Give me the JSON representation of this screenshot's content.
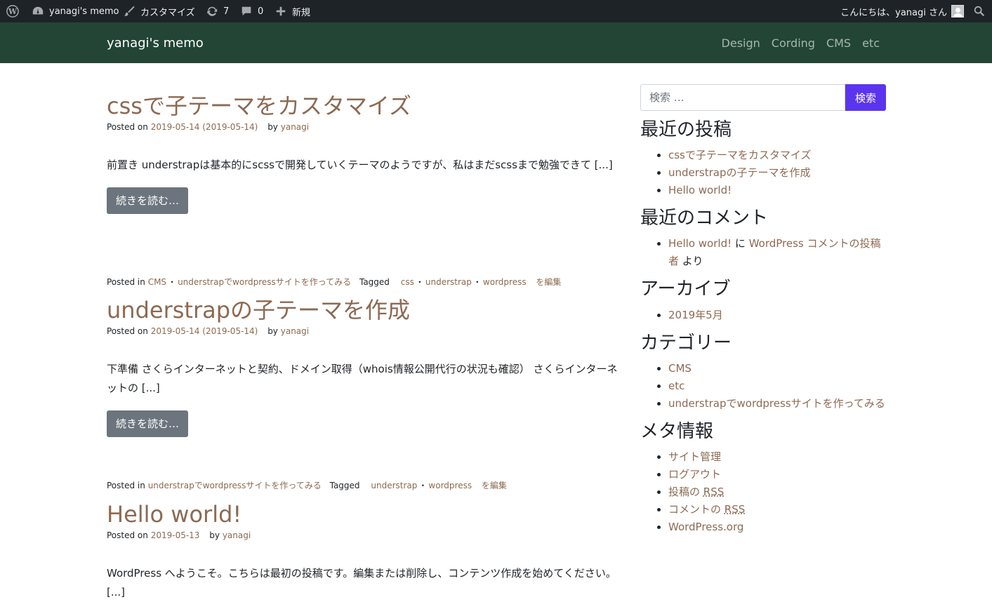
{
  "adminbar": {
    "site_name": "yanagi's memo",
    "customize": "カスタマイズ",
    "updates": "7",
    "comments": "0",
    "new": "新規",
    "greeting": "こんにちは、yanagi さん"
  },
  "navbar": {
    "brand": "yanagi's memo",
    "menu": [
      "Design",
      "Cording",
      "CMS",
      "etc"
    ]
  },
  "posts": [
    {
      "title": "cssで子テーマをカスタマイズ",
      "posted_on_label": "Posted on",
      "date": "2019-05-14 (2019-05-14)",
      "by_label": "by",
      "author": "yanagi",
      "excerpt": "前置き understrapは基本的にscssで開発していくテーマのようですが、私はまだscssまで勉強できて [...]",
      "read_more": "続きを読む…",
      "posted_in_label": "Posted in",
      "categories": [
        "CMS",
        "understrapでwordpressサイトを作ってみる"
      ],
      "tagged_label": "Tagged",
      "tags": [
        "css",
        "understrap",
        "wordpress"
      ],
      "edit": "を編集"
    },
    {
      "title": "understrapの子テーマを作成",
      "posted_on_label": "Posted on",
      "date": "2019-05-14 (2019-05-14)",
      "by_label": "by",
      "author": "yanagi",
      "excerpt": "下準備 さくらインターネットと契約、ドメイン取得（whois情報公開代行の状況も確認） さくらインターネットの [...]",
      "read_more": "続きを読む…",
      "posted_in_label": "Posted in",
      "categories": [
        "understrapでwordpressサイトを作ってみる"
      ],
      "tagged_label": "Tagged",
      "tags": [
        "understrap",
        "wordpress"
      ],
      "edit": "を編集"
    },
    {
      "title": "Hello world!",
      "posted_on_label": "Posted on",
      "date": "2019-05-13",
      "by_label": "by",
      "author": "yanagi",
      "excerpt": "WordPress へようこそ。こちらは最初の投稿です。編集または削除し、コンテンツ作成を始めてください。 [...]"
    }
  ],
  "sidebar": {
    "search_placeholder": "検索 …",
    "search_button": "検索",
    "recent_posts_title": "最近の投稿",
    "recent_posts": [
      "cssで子テーマをカスタマイズ",
      "understrapの子テーマを作成",
      "Hello world!"
    ],
    "recent_comments_title": "最近のコメント",
    "comment_post": "Hello world!",
    "comment_on": "に",
    "comment_author": "WordPress コメントの投稿者",
    "comment_suffix": "より",
    "archives_title": "アーカイブ",
    "archives": [
      "2019年5月"
    ],
    "categories_title": "カテゴリー",
    "categories": [
      "CMS",
      "etc",
      "understrapでwordpressサイトを作ってみる"
    ],
    "meta_title": "メタ情報",
    "meta_links": {
      "site_admin": "サイト管理",
      "logout": "ログアウト",
      "posts_rss_prefix": "投稿の",
      "comments_rss_prefix": "コメントの",
      "rss": "RSS",
      "wordpress_org": "WordPress.org"
    }
  }
}
